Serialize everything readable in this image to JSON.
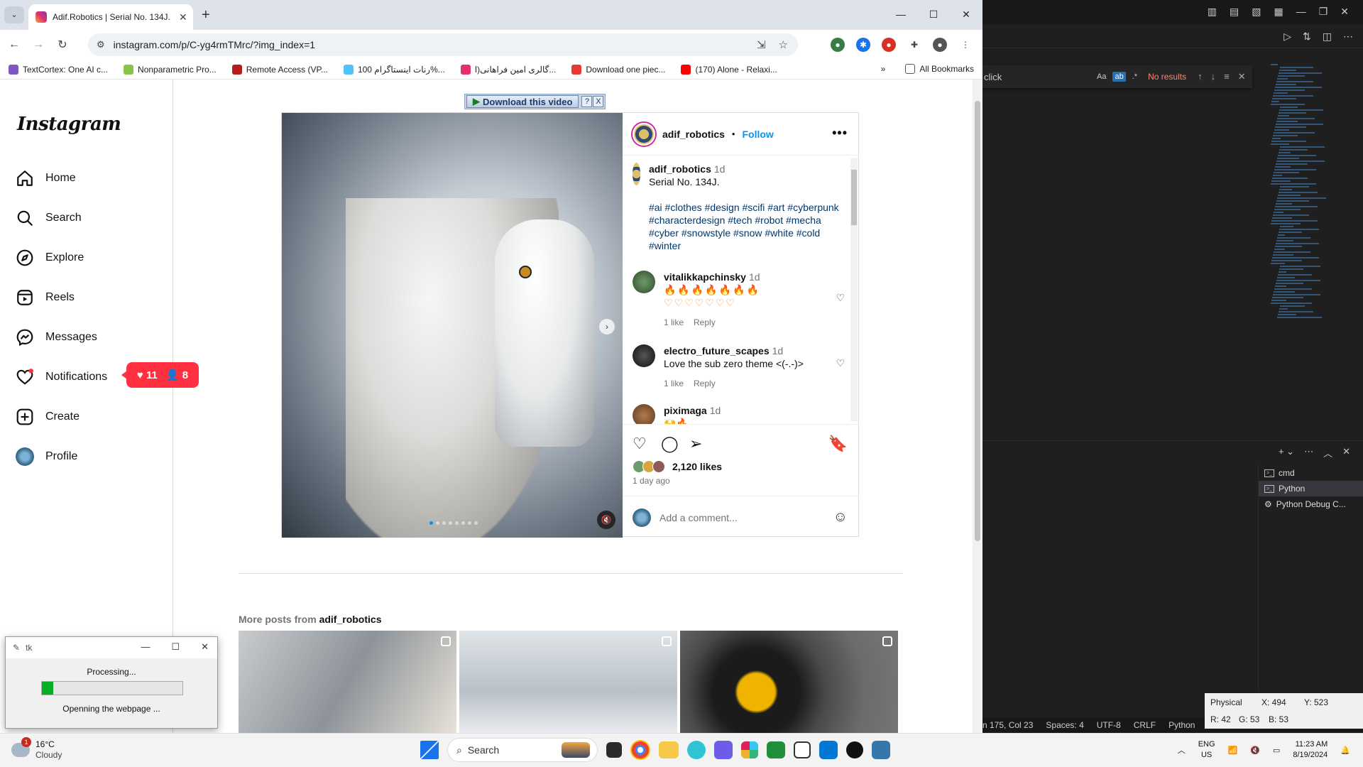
{
  "browser": {
    "tab_title": "Adif.Robotics | Serial No. 134J.",
    "url": "instagram.com/p/C-yg4rmTMrc/?img_index=1",
    "bookmarks": [
      "TextCortex: One AI c...",
      "Nonparametric Pro...",
      "Remote Access (VP...",
      "رنات اینستاگرام 100%...",
      "گالری امین فراهانی(ا...",
      "Download one piec...",
      "(170) Alone - Relaxi..."
    ],
    "all_bookmarks": "All Bookmarks"
  },
  "instagram": {
    "logo": "Instagram",
    "nav": [
      "Home",
      "Search",
      "Explore",
      "Reels",
      "Messages",
      "Notifications",
      "Create",
      "Profile"
    ],
    "notif_popup": {
      "likes": "11",
      "follows": "8"
    },
    "download_bar": {
      "label": "Download this video",
      "help": "?",
      "close": "X"
    },
    "post": {
      "username": "adif_robotics",
      "follow": "Follow",
      "caption_user": "adif_robotics",
      "caption_time": "1d",
      "caption": "Serial No. 134J.",
      "hashtags": "#ai #clothes #design #scifi #art #cyberpunk #characterdesign #tech #robot #mecha #cyber #snowstyle #snow #white #cold #winter",
      "comments": [
        {
          "user": "vitalikkapchinsky",
          "time": "1d",
          "text": "🔥🔥🔥🔥🔥🔥🔥♡♡♡♡♡♡♡",
          "likes": "1 like",
          "reply": "Reply"
        },
        {
          "user": "electro_future_scapes",
          "time": "1d",
          "text": "Love the sub zero theme <(-.-)>",
          "likes": "1 like",
          "reply": "Reply"
        },
        {
          "user": "piximaga",
          "time": "1d",
          "text": "🙌🔥",
          "likes": "",
          "reply": ""
        }
      ],
      "likes": "2,120 likes",
      "ago": "1 day ago",
      "add_comment_placeholder": "Add a comment..."
    },
    "more_posts_prefix": "More posts from",
    "more_posts_user": "adif_robotics"
  },
  "tk_window": {
    "title": "tk",
    "status": "Processing...",
    "progress": 0.08,
    "detail": "Openning the webpage ..."
  },
  "vscode": {
    "find_text": "click",
    "no_results": "No results",
    "terminals": [
      "cmd",
      "Python",
      "Python Debug C..."
    ],
    "status": [
      "n 175, Col 23",
      "Spaces: 4",
      "UTF-8",
      "CRLF",
      "Python",
      "3."
    ]
  },
  "pixel_info": {
    "mode": "Physical",
    "x": "X: 494",
    "y": "Y: 523",
    "r": "R: 42",
    "g": "G: 53",
    "b": "B: 53"
  },
  "taskbar": {
    "temp": "16°C",
    "weather": "Cloudy",
    "weather_badge": "1",
    "search": "Search",
    "lang1": "ENG",
    "lang2": "US",
    "time": "11:23 AM",
    "date": "8/19/2024"
  }
}
